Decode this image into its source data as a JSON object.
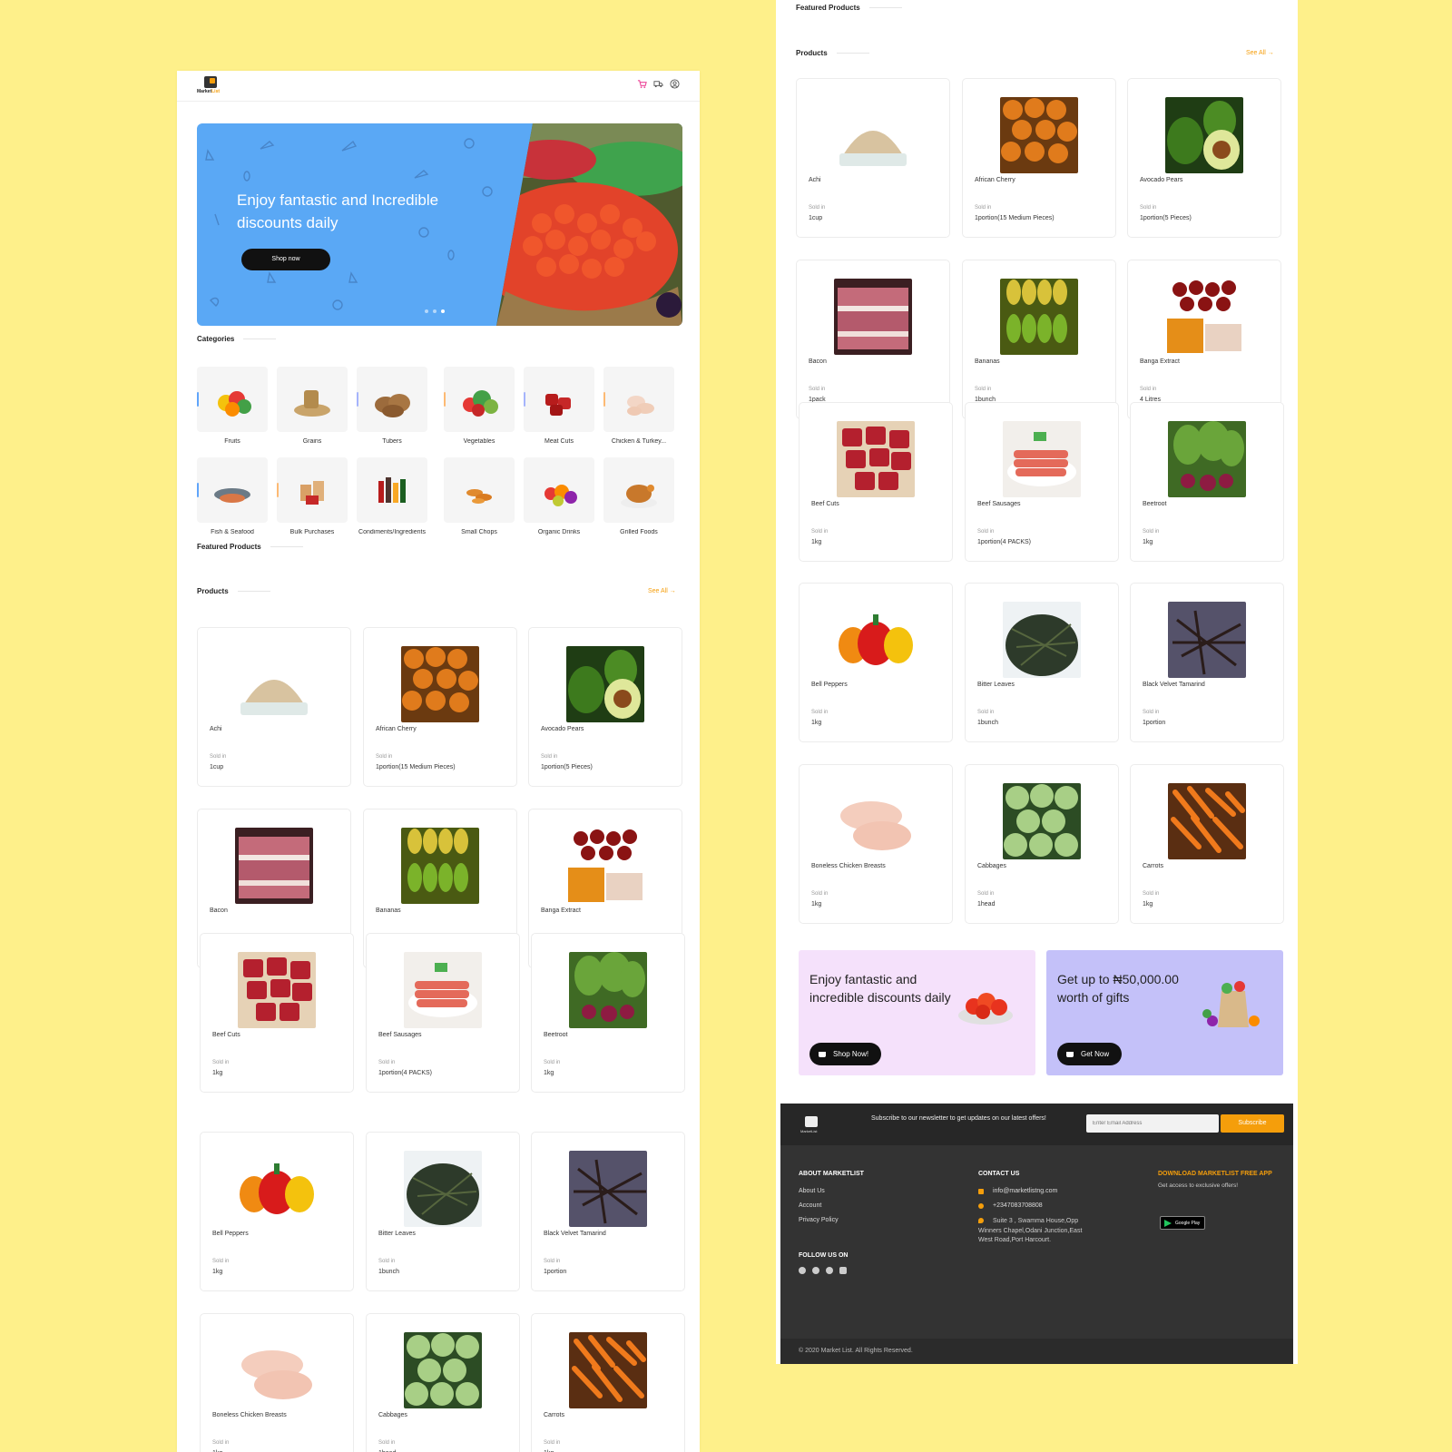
{
  "brand": {
    "logo_main": "Market",
    "logo_accent": "List"
  },
  "header_icons": [
    "cart-icon",
    "delivery-truck-icon",
    "user-account-icon"
  ],
  "hero": {
    "title": "Enjoy fantastic and Incredible discounts daily",
    "button": "Shop now",
    "slide_count": 3,
    "active_slide": 3
  },
  "sections": {
    "categories": "Categories",
    "featured": "Featured Products",
    "products": "Products",
    "see_all": "See All →"
  },
  "categories": [
    {
      "label": "Fruits",
      "bar": "#60A5FA"
    },
    {
      "label": "Grains",
      "bar": ""
    },
    {
      "label": "Tubers",
      "bar": "#A5B4FC"
    },
    {
      "label": "Vegetables",
      "bar": "#FDBA74"
    },
    {
      "label": "Meat Cuts",
      "bar": "#A5B4FC"
    },
    {
      "label": "Chicken & Turkey...",
      "bar": "#FDBA74"
    },
    {
      "label": "Fish & Seafood",
      "bar": "#60A5FA"
    },
    {
      "label": "Bulk Purchases",
      "bar": "#FDBA74"
    },
    {
      "label": "Condiments/Ingredients",
      "bar": ""
    },
    {
      "label": "Small Chops",
      "bar": ""
    },
    {
      "label": "Organic Drinks",
      "bar": ""
    },
    {
      "label": "Grilled Foods",
      "bar": ""
    }
  ],
  "sold_in_label": "Sold in",
  "products": [
    {
      "name": "Achi",
      "unit": "1cup"
    },
    {
      "name": "African Cherry",
      "unit": "1portion(15 Medium Pieces)"
    },
    {
      "name": "Avocado Pears",
      "unit": "1portion(5 Pieces)"
    },
    {
      "name": "Bacon",
      "unit": "1pack"
    },
    {
      "name": "Bananas",
      "unit": "1bunch"
    },
    {
      "name": "Banga Extract",
      "unit": "4 Litres"
    },
    {
      "name": "Beef Cuts",
      "unit": "1kg"
    },
    {
      "name": "Beef Sausages",
      "unit": "1portion(4 PACKS)"
    },
    {
      "name": "Beetroot",
      "unit": "1kg"
    },
    {
      "name": "Bell Peppers",
      "unit": "1kg"
    },
    {
      "name": "Bitter Leaves",
      "unit": "1bunch"
    },
    {
      "name": "Black Velvet Tamarind",
      "unit": "1portion"
    },
    {
      "name": "Boneless Chicken Breasts",
      "unit": "1kg"
    },
    {
      "name": "Cabbages",
      "unit": "1head"
    },
    {
      "name": "Carrots",
      "unit": "1kg"
    }
  ],
  "promos": [
    {
      "title": "Enjoy fantastic and incredible discounts daily",
      "button": "Shop Now!",
      "bg": "#F5E1FB"
    },
    {
      "title": "Get up to ₦50,000.00 worth of gifts",
      "button": "Get Now",
      "bg": "#C4C1F9"
    }
  ],
  "footer": {
    "logo": "MarketList",
    "newsletter": "Subscribe to our newsletter to get updates on our latest offers!",
    "email_placeholder": "Enter Email Address",
    "subscribe": "Subscribe",
    "about_heading": "ABOUT MARKETLIST",
    "about_links": [
      "About Us",
      "Account",
      "Privacy Policy"
    ],
    "follow_heading": "FOLLOW US ON",
    "socials": [
      "facebook-icon",
      "dribbble-icon",
      "twitter-icon",
      "instagram-icon"
    ],
    "contact_heading": "CONTACT US",
    "email": "info@marketlistng.com",
    "phone": "+2347083708808",
    "address": "Suite 3 , Swamma House,Opp Winners Chapel,Odani Junction,East West Road,Port Harcourt.",
    "app_heading": "DOWNLOAD MARKETLIST FREE APP",
    "app_sub": "Get access to exclusive offers!",
    "app_badge": "Google Play",
    "copyright": "© 2020 Market List. All Rights Reserved."
  },
  "colors": {
    "accent": "#F59E0B",
    "hero_blue": "#5AA8F5",
    "cart_pink": "#EC4899",
    "footer_dark": "#333333"
  }
}
